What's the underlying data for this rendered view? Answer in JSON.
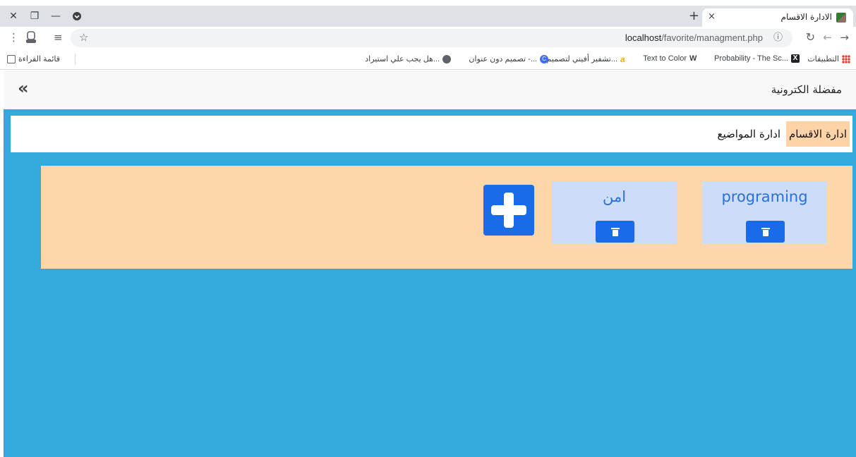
{
  "browser": {
    "tab": {
      "title": "الادارة الاقسام",
      "close": "×"
    },
    "new_tab": "+",
    "window_controls": {
      "close": "✕",
      "restore": "❐",
      "minimize": "—"
    },
    "url": {
      "host": "localhost",
      "path": "/favorite/managment.php"
    },
    "bookmarks": [
      {
        "label": "التطبيقات",
        "icon": "apps-grid-icon",
        "color": "#e94235"
      },
      {
        "label": "Probability - The Sc...",
        "icon": "x-logo-icon",
        "color": "#202124"
      },
      {
        "label": "Text to Color",
        "icon": "w-logo-icon",
        "color": "#202124"
      },
      {
        "label": "تشفير أفيني لتصميم...",
        "icon": "a-logo-icon",
        "color": "#f5a623"
      },
      {
        "label": "تصميم دون عنوان -...",
        "icon": "canva-icon",
        "color": "#3d6fe6"
      },
      {
        "label": "هل يجب علي استيراد...",
        "icon": "globe-icon",
        "color": "#5f6368"
      }
    ],
    "reading_list": "قائمة القراءة"
  },
  "page": {
    "brand": "مفضلة الكترونية",
    "collapse_icon": "«",
    "subnav": [
      {
        "label": "ادارة الاقسام",
        "active": true
      },
      {
        "label": "ادارة المواضيع",
        "active": false
      }
    ],
    "categories": [
      {
        "title": "programing"
      },
      {
        "title": "امن"
      }
    ]
  },
  "colors": {
    "page_bg": "#34aadc",
    "panel_bg": "#ffd6a9",
    "card_bg": "#cddcf7",
    "button_blue": "#1a6be8",
    "active_tab": "#ffd3a8"
  }
}
